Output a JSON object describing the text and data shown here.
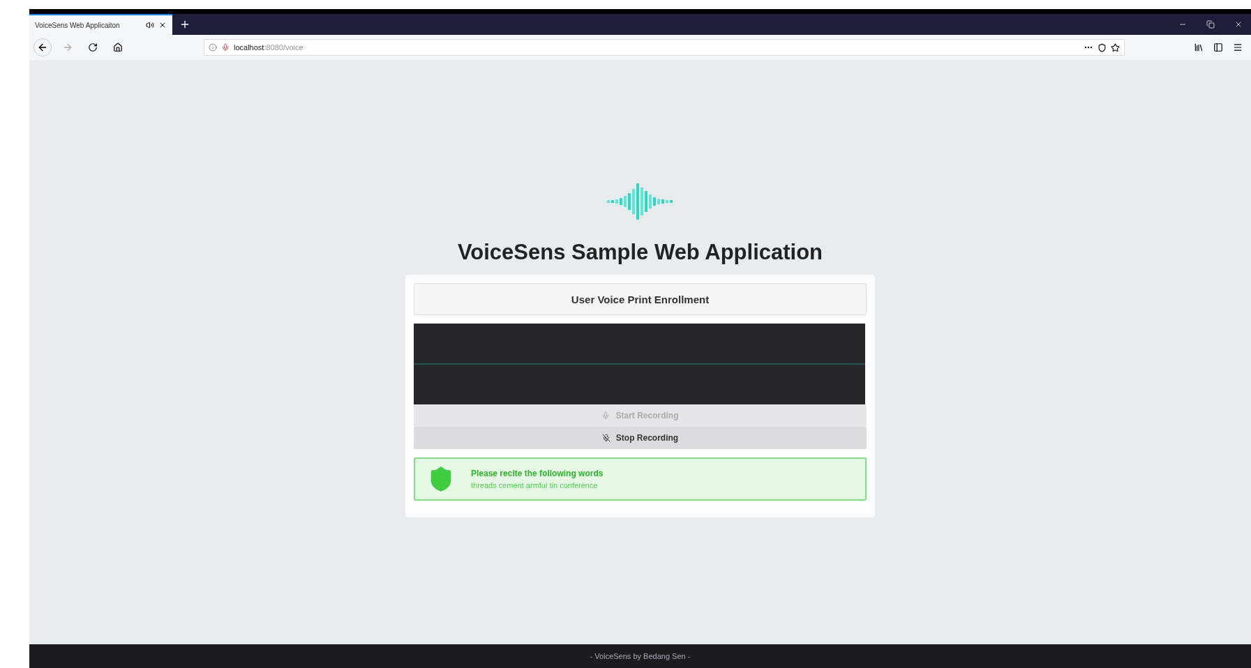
{
  "browser": {
    "tabs": [
      {
        "title": "VoiceSens Web Applicaiton",
        "selected": true,
        "audio": true
      }
    ],
    "address": {
      "host": "localhost",
      "rest": ":8080/voice"
    }
  },
  "page": {
    "title": "VoiceSens Sample Web Application",
    "panel_title": "User Voice Print Enrollment",
    "buttons": [
      {
        "kind": "start",
        "label": "Start Recording",
        "disabled": true
      },
      {
        "kind": "stop",
        "label": "Stop Recording",
        "disabled": false
      }
    ],
    "alert": {
      "title": "Please recite the following words",
      "words": "threads cement armful tin conference"
    }
  },
  "footer": "- VoiceSens by Bedang Sen -"
}
